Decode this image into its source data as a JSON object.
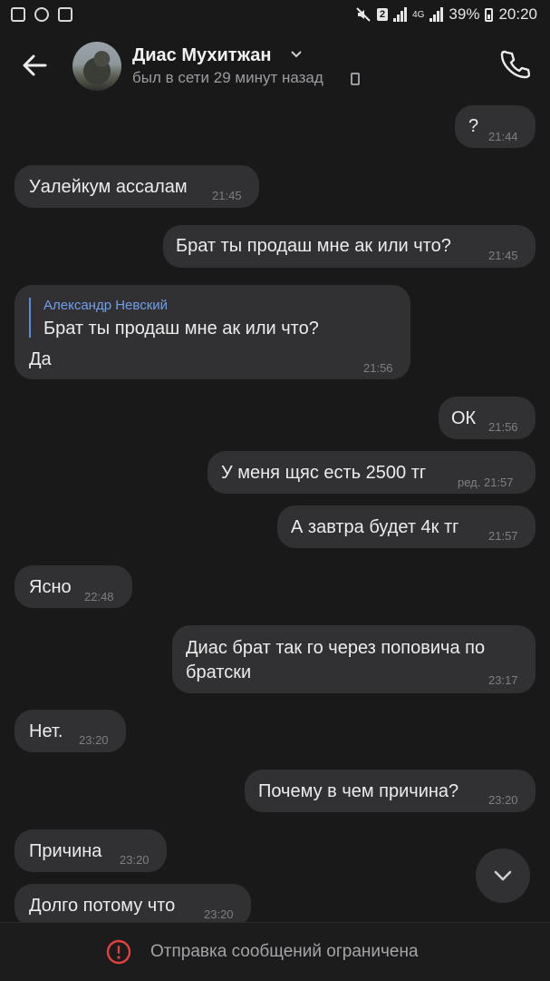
{
  "status_bar": {
    "battery": "39%",
    "time": "20:20",
    "sim_badge": "2",
    "net_label": "4G",
    "icons": [
      "gallery-icon",
      "whatsapp-icon",
      "checkbox-icon",
      "mute-icon",
      "signal-icon",
      "battery-icon"
    ]
  },
  "header": {
    "contact_name": "Диас Мухитжан",
    "last_seen": "был в сети 29 минут назад",
    "icons": [
      "back-arrow-icon",
      "chevron-down-icon",
      "phone-icon",
      "mobile-device-icon"
    ]
  },
  "messages": [
    {
      "side": "out",
      "text": "?",
      "time": "21:44"
    },
    {
      "side": "in",
      "text": "Уалейкум ассалам",
      "time": "21:45"
    },
    {
      "side": "out",
      "text": "Брат ты продаш мне ак или что?",
      "time": "21:45"
    },
    {
      "side": "in",
      "reply_author": "Александр Невский",
      "reply_text": "Брат ты продаш мне ак или что?",
      "text": "Да",
      "time": "21:56"
    },
    {
      "side": "out",
      "text": "ОК",
      "time": "21:56"
    },
    {
      "side": "out",
      "text": "У меня щяс есть 2500 тг",
      "time": "ред. 21:57"
    },
    {
      "side": "out",
      "text": "А завтра будет 4к тг",
      "time": "21:57"
    },
    {
      "side": "in",
      "text": "Ясно",
      "time": "22:48"
    },
    {
      "side": "out",
      "text_line1": "Диас брат так го через поповича по",
      "text_line2": "братски",
      "time": "23:17"
    },
    {
      "side": "in",
      "text": "Нет.",
      "time": "23:20"
    },
    {
      "side": "out",
      "text": "Почему в чем причина?",
      "time": "23:20"
    },
    {
      "side": "in",
      "text": "Причина",
      "time": "23:20"
    },
    {
      "side": "in",
      "text": "Долго потому что",
      "time": "23:20"
    }
  ],
  "footer": {
    "notice": "Отправка сообщений ограничена",
    "icon": "alert-circle-icon"
  },
  "colors": {
    "background": "#19191a",
    "bubble": "#313134",
    "accent_link": "#6f9fe8",
    "alert_red": "#e2403d"
  }
}
